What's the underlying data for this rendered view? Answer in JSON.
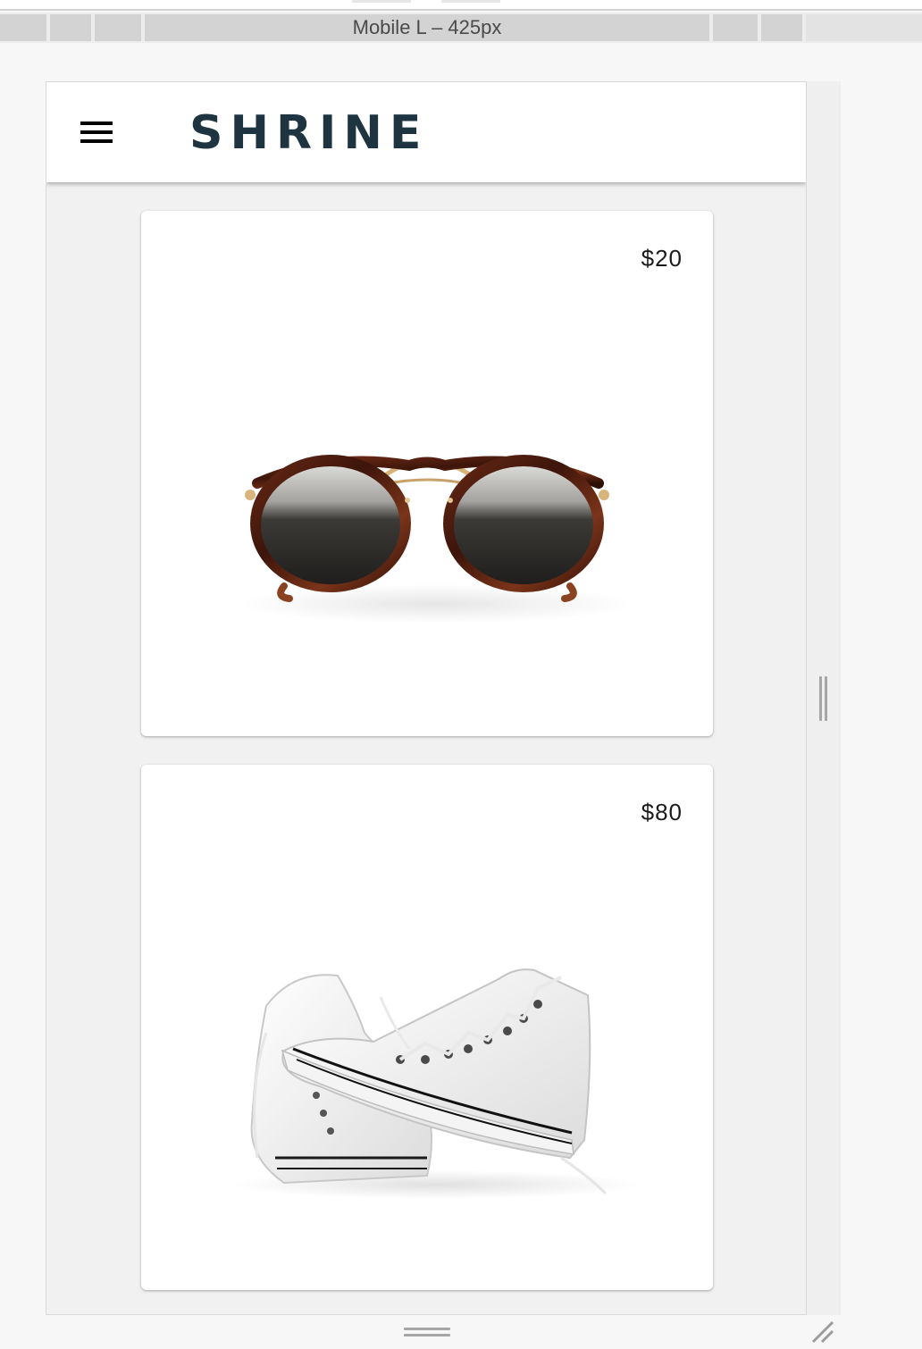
{
  "devtools": {
    "device_label": "Mobile L – 425px"
  },
  "app": {
    "title": "SHRINE",
    "menu_icon": "hamburger-menu-icon",
    "brand_color": "#1e3441"
  },
  "products": [
    {
      "price": "$20",
      "image": "sunglasses"
    },
    {
      "price": "$80",
      "image": "white-high-top-sneakers"
    }
  ]
}
